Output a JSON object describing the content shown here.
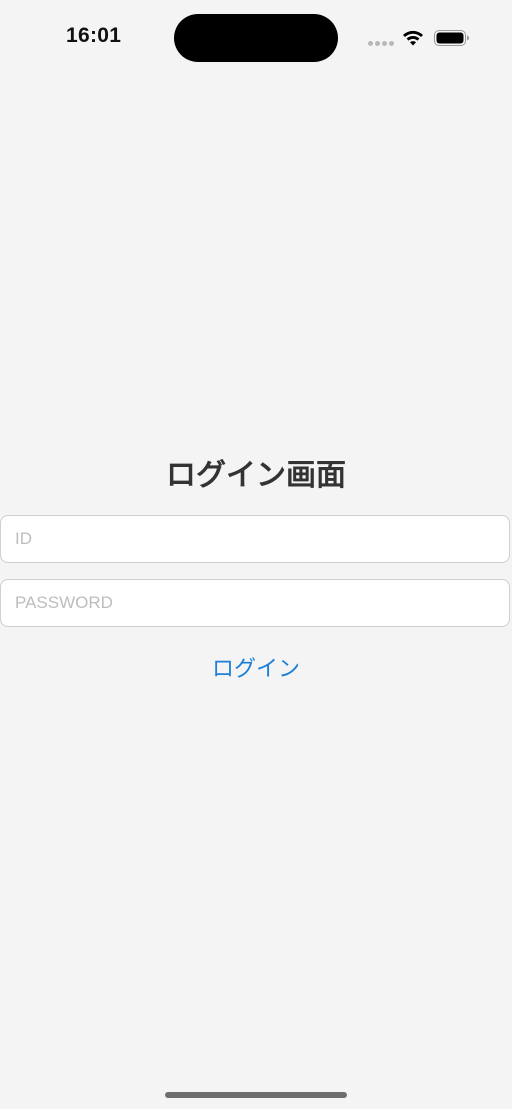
{
  "status_bar": {
    "time": "16:01"
  },
  "login": {
    "title": "ログイン画面",
    "id_placeholder": "ID",
    "password_placeholder": "PASSWORD",
    "button_label": "ログイン"
  },
  "colors": {
    "background": "#f4f4f4",
    "accent": "#1e7fd6",
    "title_text": "#333333",
    "field_border": "#cfcfcf",
    "placeholder": "#bdbdbd"
  },
  "icons": {
    "signal": "cellular-signal-icon",
    "wifi": "wifi-icon",
    "battery": "battery-icon"
  }
}
